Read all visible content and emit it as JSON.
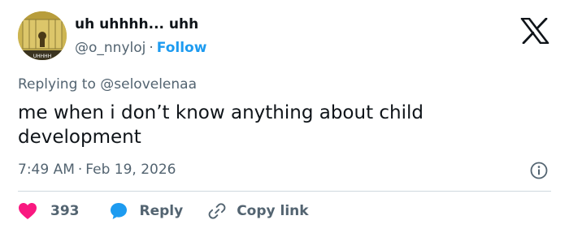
{
  "author": {
    "display_name": "uh uhhhh... uhh",
    "handle": "@o_nnyloj",
    "separator": "·",
    "follow_label": "Follow",
    "avatar_caption": "UHHHH"
  },
  "reply_context": {
    "prefix": "Replying to",
    "mention": "@selovelenaa"
  },
  "tweet": {
    "text": "me when i don’t know anything about child development",
    "time": "7:49 AM",
    "separator": "·",
    "date": "Feb 19, 2026"
  },
  "actions": {
    "like_count": "393",
    "reply_label": "Reply",
    "copy_label": "Copy link"
  },
  "icons": {
    "brand": "x-logo-icon",
    "info": "info-icon",
    "like": "heart-icon",
    "reply": "speech-bubble-icon",
    "copy": "link-icon"
  },
  "colors": {
    "accent": "#1d9bf0",
    "like": "#f91880",
    "muted": "#536471",
    "text": "#0f1419",
    "divider": "#cfd9de"
  }
}
